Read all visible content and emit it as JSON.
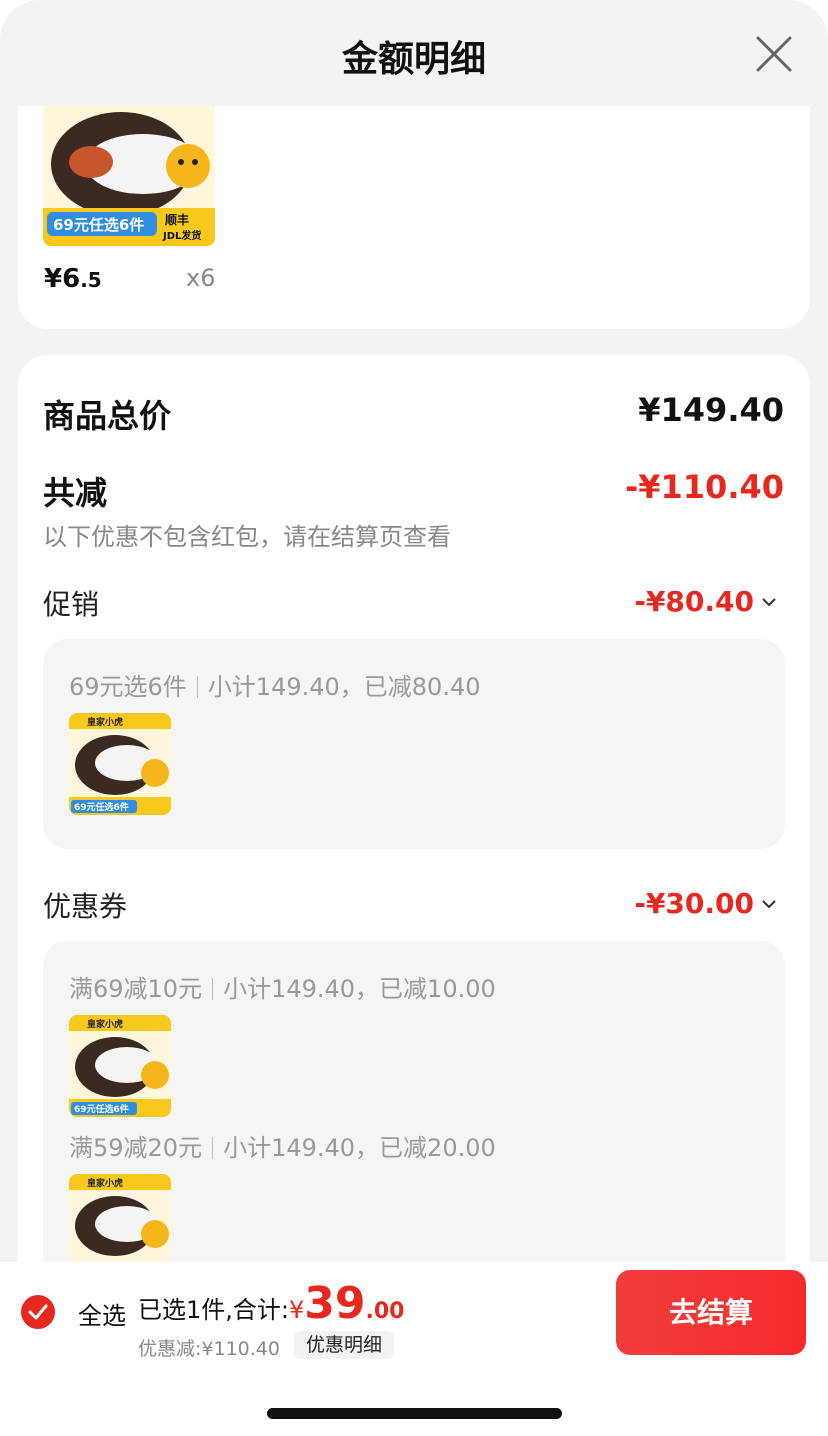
{
  "header": {
    "title": "金额明细"
  },
  "product": {
    "price_int": "¥6",
    "price_dec": ".5",
    "qty": "x6"
  },
  "thumb_text": {
    "promo": "69元任选6件",
    "ship": "顺丰",
    "jdl": "JDL发货",
    "brand": "皇家小虎"
  },
  "summary": {
    "total_label": "商品总价",
    "total_value": "¥149.40",
    "reduce_label": "共减",
    "reduce_value": "-¥110.40",
    "note": "以下优惠不包含红包，请在结算页查看"
  },
  "promotion": {
    "label": "促销",
    "value": "-¥80.40",
    "rule_a": "69元选6件",
    "rule_b": "小计149.40，已减80.40"
  },
  "coupon": {
    "label": "优惠券",
    "value": "-¥30.00",
    "rules": [
      {
        "a": "满69减10元",
        "b": "小计149.40，已减10.00"
      },
      {
        "a": "满59减20元",
        "b": "小计149.40，已减20.00"
      }
    ]
  },
  "bottom": {
    "select_all": "全选",
    "selected_text": "已选1件,合计:",
    "amount_yen": "¥",
    "amount_int": "39",
    "amount_dec": ".00",
    "discount": "优惠减:¥110.40",
    "detail_link": "优惠明细",
    "checkout": "去结算"
  },
  "colors": {
    "accent": "#e8281e",
    "checkout": "#f52a2a"
  }
}
